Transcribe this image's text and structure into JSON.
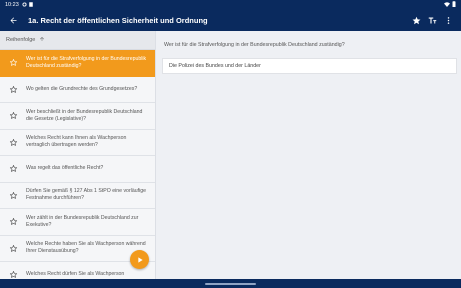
{
  "status_bar": {
    "time": "10:23",
    "icons": [
      "settings-icon",
      "sim-icon"
    ],
    "right_icons": [
      "wifi-icon",
      "battery-icon"
    ]
  },
  "app_bar": {
    "title": "1a. Recht der öffentlichen Sicherheit und Ordnung",
    "icons": [
      "back-arrow-icon",
      "star-icon",
      "text-size-icon",
      "more-vert-icon"
    ]
  },
  "sort_header": {
    "label": "Reihenfolge",
    "icon": "arrow-up-icon"
  },
  "questions": [
    {
      "text": "Wer ist für die Strafverfolgung in der Bundesrepublik Deutschland zuständig?",
      "active": true
    },
    {
      "text": "Wo gelten die Grundrechte des Grundgesetzes?",
      "active": false
    },
    {
      "text": "Wer beschließt in der Bundesrepublik Deutschland die Gesetze (Legislative)?",
      "active": false
    },
    {
      "text": "Welches Recht kann Ihnen als Wachperson vertraglich übertragen werden?",
      "active": false
    },
    {
      "text": "Was regelt das öffentliche Recht?",
      "active": false
    },
    {
      "text": "Dürfen Sie gemäß § 127 Abs 1 StPO eine vorläufige Festnahme durchführen?",
      "active": false
    },
    {
      "text": "Wer zählt in der Bundesrepublik Deutschland zur Exekutive?",
      "active": false
    },
    {
      "text": "Welche Rechte haben Sie als Wachperson während Ihrer Dienstausübung?",
      "active": false
    },
    {
      "text": "Welches Recht dürfen Sie als Wachperson",
      "active": false
    }
  ],
  "detail": {
    "question": "Wer ist für die Strafverfolgung in der Bundesrepublik Deutschland zuständig?",
    "answer": "Die Polizei des Bundes und der Länder"
  },
  "colors": {
    "primary": "#0a2a5e",
    "accent": "#f29a1c"
  }
}
